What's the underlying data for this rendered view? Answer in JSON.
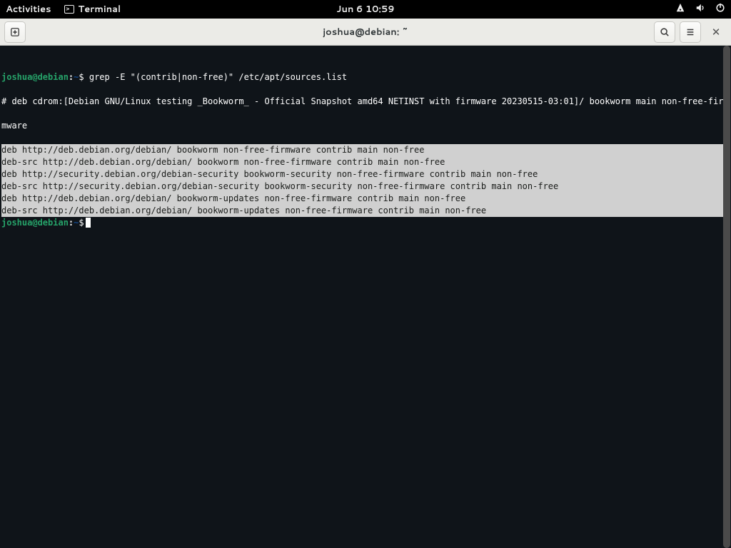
{
  "topbar": {
    "activities": "Activities",
    "app_name": "Terminal",
    "clock": "Jun 6  10:59"
  },
  "window": {
    "title": "joshua@debian: ~"
  },
  "terminal": {
    "prompt": {
      "user_host": "joshua@debian",
      "path": "~",
      "symbol": "$"
    },
    "command": "grep -E \"(contrib|non-free)\" /etc/apt/sources.list",
    "output_comment_l1": "# deb cdrom:[Debian GNU/Linux testing _Bookworm_ - Official Snapshot amd64 NETINST with firmware 20230515-03:01]/ bookworm main non-free-fir",
    "output_comment_l2": "mware",
    "matches": [
      "deb http://deb.debian.org/debian/ bookworm non-free-firmware contrib main non-free",
      "deb-src http://deb.debian.org/debian/ bookworm non-free-firmware contrib main non-free",
      "deb http://security.debian.org/debian-security bookworm-security non-free-firmware contrib main non-free",
      "deb-src http://security.debian.org/debian-security bookworm-security non-free-firmware contrib main non-free",
      "deb http://deb.debian.org/debian/ bookworm-updates non-free-firmware contrib main non-free",
      "deb-src http://deb.debian.org/debian/ bookworm-updates non-free-firmware contrib main non-free"
    ]
  }
}
